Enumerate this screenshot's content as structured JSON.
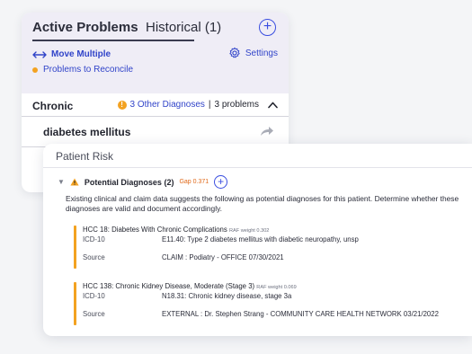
{
  "problems": {
    "tabs": {
      "active": "Active Problems",
      "historical": "Historical (1)"
    },
    "add_icon": "plus-circle-icon",
    "actions": {
      "move_multiple": "Move Multiple",
      "settings": "Settings",
      "reconcile": "Problems to Reconcile"
    },
    "section": {
      "label": "Chronic",
      "other_diagnoses": "3 Other Diagnoses",
      "separator": "|",
      "count": "3 problems"
    },
    "items": [
      {
        "name": "diabetes mellitus"
      }
    ]
  },
  "risk": {
    "title": "Patient Risk",
    "potential": {
      "label": "Potential Diagnoses (2)",
      "gap": "Gap 0.371"
    },
    "description": "Existing clinical and claim data suggests the following as potential diagnoses for this patient. Determine whether these diagnoses are valid and document accordingly.",
    "diagnoses": [
      {
        "hcc": "HCC 18:",
        "name": "Diabetes With Chronic Complications",
        "raf": "RAF weight 0.302",
        "icd_label": "ICD-10",
        "icd_value": "E11.40: Type 2 diabetes mellitus with diabetic neuropathy, unsp",
        "source_label": "Source",
        "source_value": "CLAIM : Podiatry - OFFICE 07/30/2021"
      },
      {
        "hcc": "HCC 138:",
        "name": "Chronic Kidney Disease, Moderate (Stage 3)",
        "raf": "RAF weight 0.069",
        "icd_label": "ICD-10",
        "icd_value": "N18.31: Chronic kidney disease, stage 3a",
        "source_label": "Source",
        "source_value": "EXTERNAL : Dr. Stephen Strang - COMMUNITY CARE HEALTH NETWORK 03/21/2022"
      }
    ]
  },
  "colors": {
    "accent_blue": "#3144c9",
    "warning_orange": "#f3a221",
    "gap_orange": "#e06a1b",
    "header_lavender": "#efedf6"
  }
}
